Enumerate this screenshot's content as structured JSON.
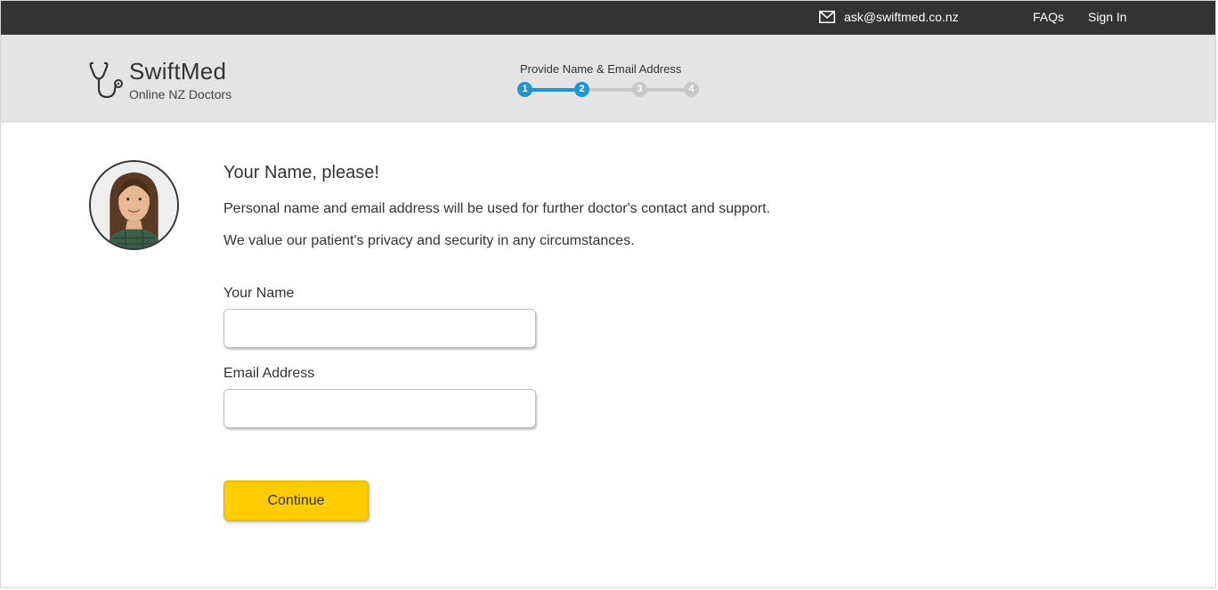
{
  "topbar": {
    "email": "ask@swiftmed.co.nz",
    "faq_label": "FAQs",
    "signin_label": "Sign In",
    "background": "#333333"
  },
  "brand": {
    "name": "SwiftMed",
    "tagline": "Online NZ Doctors"
  },
  "progress": {
    "title": "Provide Name & Email Address",
    "current_step": 2,
    "total_steps": 4,
    "steps": [
      "1",
      "2",
      "3",
      "4"
    ],
    "active_color": "#1e96d2",
    "inactive_color": "#c8c8c8"
  },
  "intro": {
    "heading": "Your Name, please!",
    "line1": "Personal name and email address will be used for further doctor's contact and support.",
    "line2": "We value our patient's privacy and security in any circumstances."
  },
  "form": {
    "name_label": "Your Name",
    "name_value": "",
    "email_label": "Email Address",
    "email_value": "",
    "continue_label": "Continue",
    "button_color": "#ffcc00"
  }
}
